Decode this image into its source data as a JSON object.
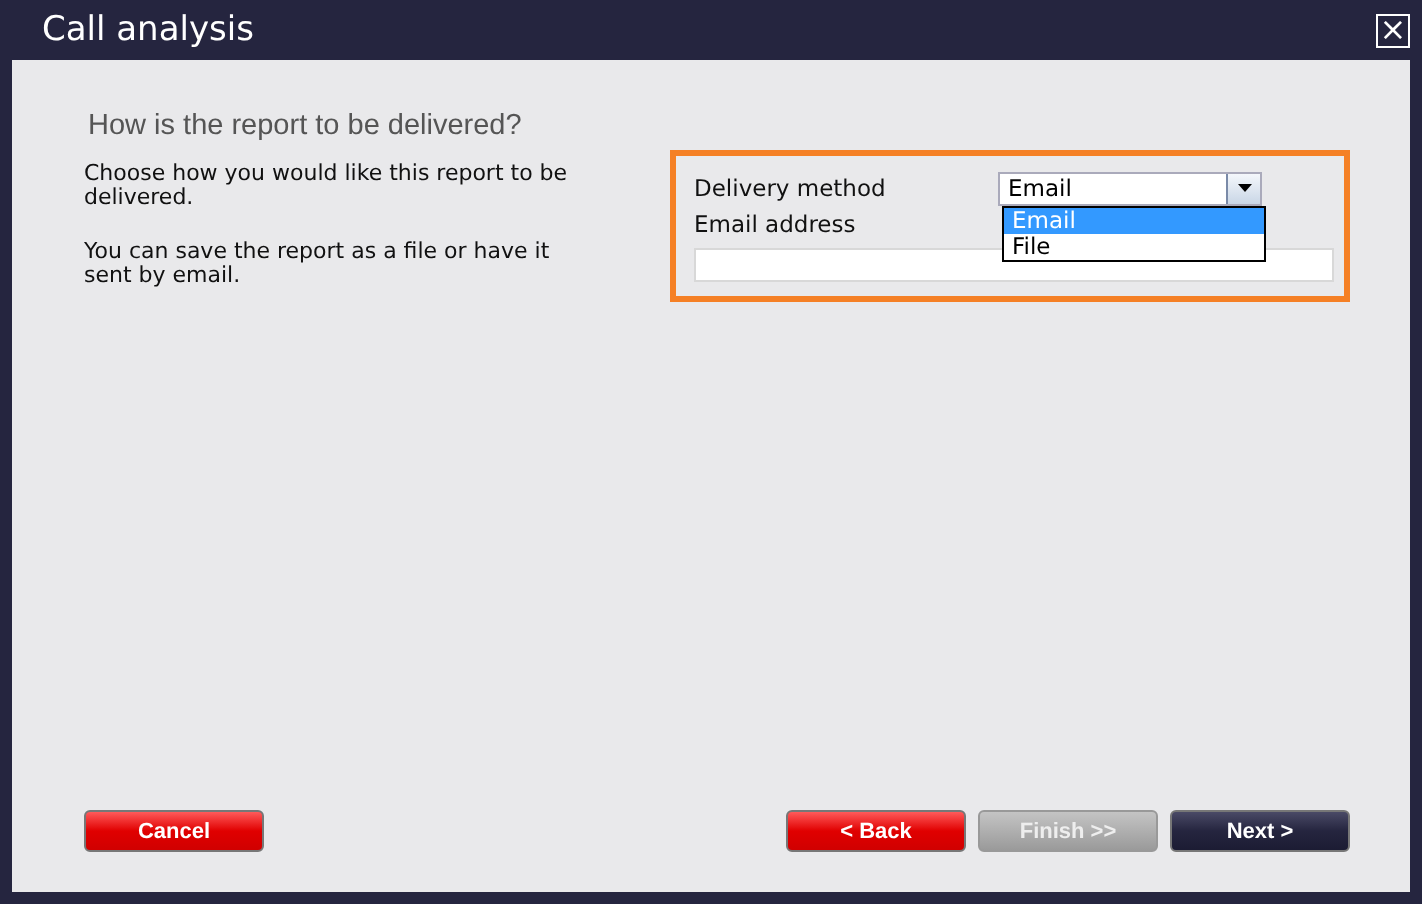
{
  "window": {
    "title": "Call analysis",
    "close": "×"
  },
  "heading": "How is the report to be delivered?",
  "paragraphs": [
    "Choose how you would like this report to be delivered.",
    "You can save the report as a file or have it sent by email."
  ],
  "form": {
    "delivery_label": "Delivery method",
    "delivery_value": "Email",
    "dropdown_expanded": true,
    "options": [
      {
        "label": "Email",
        "selected": true
      },
      {
        "label": "File",
        "selected": false
      }
    ],
    "email_label": "Email address"
  },
  "buttons": [
    {
      "label": "Cancel",
      "kind": "danger",
      "disabled": false
    },
    {
      "label": "< Back",
      "kind": "danger",
      "disabled": false
    },
    {
      "label": "Finish >>",
      "kind": "primary",
      "disabled": true
    },
    {
      "label": "Next >",
      "kind": "primary",
      "disabled": false
    }
  ]
}
